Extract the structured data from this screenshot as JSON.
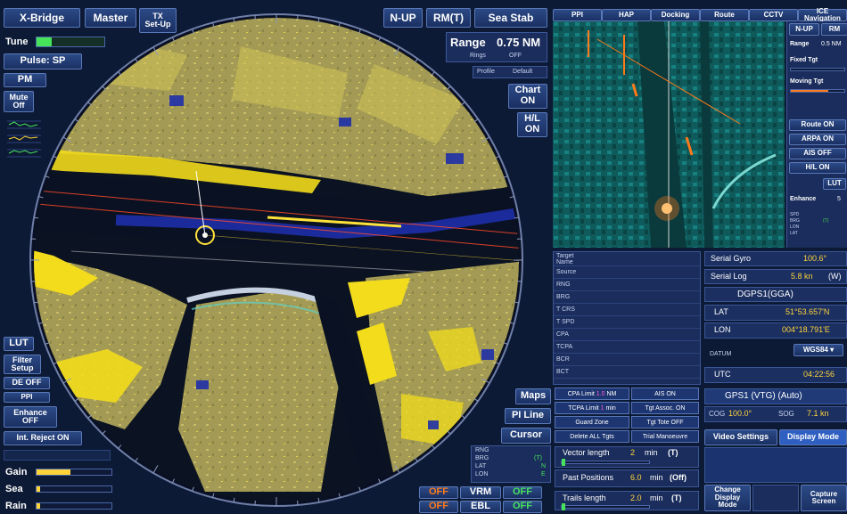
{
  "left": {
    "x_bridge": "X-Bridge",
    "master": "Master",
    "tx_setup": "TX\nSet-Up",
    "tune": "Tune",
    "tune_value": "",
    "pulse": "Pulse: SP",
    "pm": "PM",
    "mute": "Mute\nOff",
    "lut": "LUT",
    "filter_setup": "Filter\nSetup",
    "de_off": "DE OFF",
    "ppi": "PPI",
    "enhance": "Enhance\nOFF",
    "int_reject": "Int. Reject ON",
    "gain": "Gain",
    "gain_level": 0.45,
    "sea": "Sea",
    "sea_level": 0.05,
    "rain": "Rain",
    "rain_level": 0.05
  },
  "top": {
    "n_up": "N-UP",
    "rm": "RM(T)",
    "sea_stab": "Sea Stab",
    "range_label": "Range",
    "range_value": "0.75 NM",
    "rings_label": "Rings",
    "rings_value": "OFF",
    "profile_label": "Profile",
    "profile_value": "Default",
    "chart_on": "Chart\nON",
    "hl_on": "H/L\nON"
  },
  "bottom_center": {
    "maps": "Maps",
    "pi_line": "PI Line",
    "cursor": "Cursor",
    "rng": "RNG",
    "brg": "BRG",
    "lat": "LAT",
    "lon": "LON",
    "brg_value": "(T)",
    "lat_value": "N",
    "lon_value": "E",
    "off1": "OFF",
    "off2": "OFF",
    "vrm": "VRM",
    "ebl": "EBL",
    "off3": "OFF",
    "off4": "OFF"
  },
  "right_tabs": [
    "PPI",
    "HAP",
    "Docking",
    "Route",
    "CCTV",
    "ICE Navigation"
  ],
  "ice_panel": {
    "n_up": "N-UP",
    "rm": "RM",
    "range": "Range",
    "range_value": "0.5 NM",
    "fixed_tgt": "Fixed Tgt",
    "moving_tgt": "Moving Tgt",
    "route_on": "Route ON",
    "arpa_on": "ARPA ON",
    "ais_off": "AIS OFF",
    "hl_on": "H/L ON",
    "lut": "LUT",
    "enhance": "Enhance",
    "enhance_value": "5",
    "spd": "SPD",
    "brg": "BRG",
    "lon": "LON",
    "lat": "LAT",
    "brg_value": "(T)"
  },
  "target_table": {
    "rows": [
      "Target\nName",
      "Source",
      "RNG",
      "BRG",
      "T CRS",
      "T SPD",
      "CPA",
      "TCPA",
      "BCR",
      "BCT"
    ]
  },
  "target_controls": {
    "cpa_limit": "CPA Limit",
    "cpa_value": "1.0",
    "cpa_unit": "NM",
    "ais_on": "AIS ON",
    "tcpa_limit": "TCPA Limit",
    "tcpa_value": "1",
    "tcpa_unit": "min",
    "tgt_assoc": "Tgt Assoc. ON",
    "guard_zone": "Guard Zone",
    "tgt_tote": "Tgt Tote OFF",
    "delete_all": "Delete ALL Tgts",
    "trial_maneuvre": "Trial Manoeuvre",
    "vector_length": "Vector length",
    "vector_value": "2",
    "vector_unit": "min",
    "vector_mode": "(T)",
    "past_positions": "Past Positions",
    "past_value": "6.0",
    "past_unit": "min",
    "past_mode": "(Off)",
    "trails_length": "Trails length",
    "trails_value": "2.0",
    "trails_unit": "min",
    "trails_mode": "(T)"
  },
  "gps": {
    "serial_gyro": "Serial Gyro",
    "gyro_value": "100.6°",
    "serial_log": "Serial Log",
    "log_value": "5.8 kn",
    "log_mode": "(W)",
    "dgps": "DGPS1(GGA)",
    "lat_label": "LAT",
    "lat_value": "51°53.657'N",
    "lon_label": "LON",
    "lon_value": "004°18.791'E",
    "datum": "DATUM",
    "datum_value": "WGS84",
    "utc": "UTC",
    "utc_value": "04:22:56",
    "gps1": "GPS1 (VTG) (Auto)",
    "cog": "COG",
    "cog_value": "100.0°",
    "sog": "SOG",
    "sog_value": "7.1 kn",
    "video_settings": "Video Settings",
    "display_mode": "Display Mode",
    "change_display": "Change\nDisplay Mode",
    "capture": "Capture\nScreen"
  },
  "colors": {
    "accent": "#2c4a86",
    "yellow": "#ffd43a",
    "green": "#46e25a",
    "orange": "#ff7a1a"
  }
}
